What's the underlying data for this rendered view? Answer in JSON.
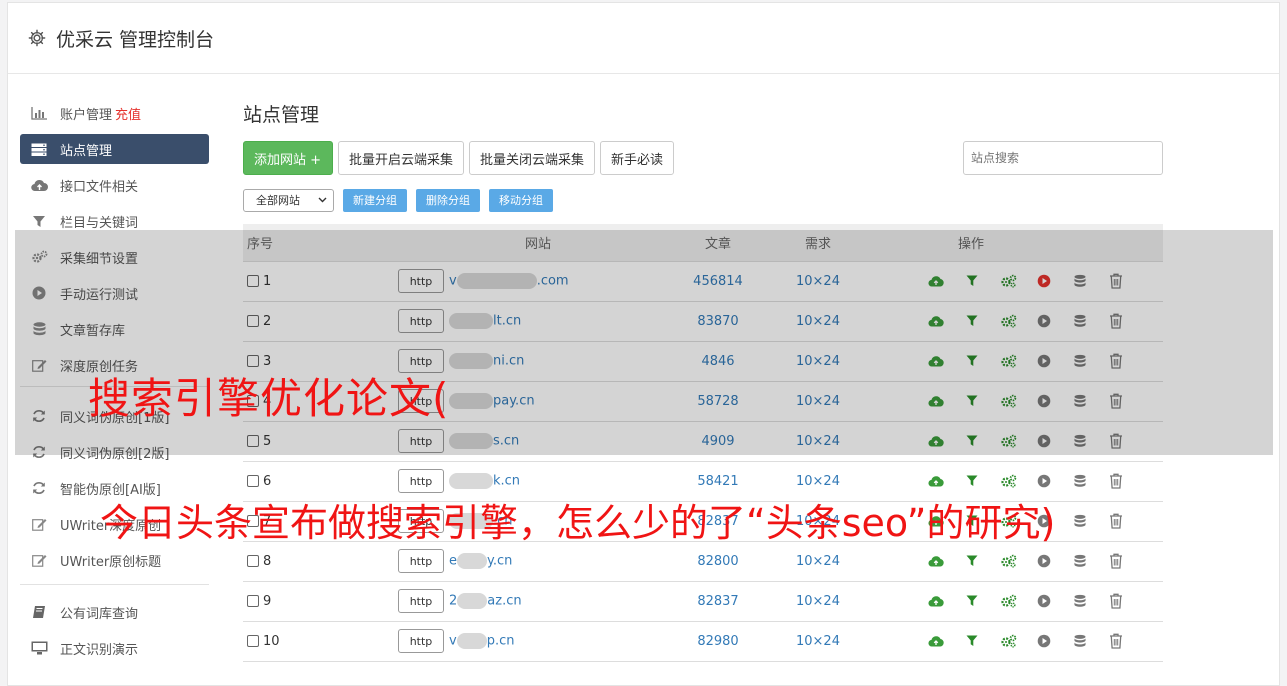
{
  "header": {
    "title": "优采云 管理控制台"
  },
  "sidebar": {
    "items": [
      {
        "label": "账户管理",
        "tag": "充值",
        "icon": "bar-chart-icon"
      },
      {
        "label": "站点管理",
        "icon": "server-icon",
        "active": true
      },
      {
        "label": "接口文件相关",
        "icon": "cloud-upload-icon"
      },
      {
        "label": "栏目与关键词",
        "icon": "filter-icon"
      },
      {
        "label": "采集细节设置",
        "icon": "cogs-icon"
      },
      {
        "label": "手动运行测试",
        "icon": "play-icon"
      },
      {
        "label": "文章暂存库",
        "icon": "database-icon"
      },
      {
        "label": "深度原创任务",
        "icon": "edit-icon"
      }
    ],
    "items2": [
      {
        "label": "同义词伪原创[1版]",
        "icon": "refresh-icon"
      },
      {
        "label": "同义词伪原创[2版]",
        "icon": "refresh-icon"
      },
      {
        "label": "智能伪原创[AI版]",
        "icon": "refresh-icon"
      },
      {
        "label": "UWriter深度原创",
        "icon": "edit-icon"
      },
      {
        "label": "UWriter原创标题",
        "icon": "edit-icon"
      }
    ],
    "items3": [
      {
        "label": "公有词库查询",
        "icon": "book-icon"
      },
      {
        "label": "正文识别演示",
        "icon": "monitor-icon"
      }
    ]
  },
  "main": {
    "title": "站点管理",
    "add_button": "添加网站 +",
    "batch_open": "批量开启云端采集",
    "batch_close": "批量关闭云端采集",
    "newbie": "新手必读",
    "search_placeholder": "站点搜索",
    "group_select": "全部网站",
    "new_group": "新建分组",
    "delete_group": "删除分组",
    "move_group": "移动分组"
  },
  "table": {
    "headers": {
      "idx": "序号",
      "site": "网站",
      "articles": "文章",
      "demand": "需求",
      "ops": "操作"
    },
    "rows": [
      {
        "idx": "1",
        "proto": "http",
        "pre": "v",
        "suf": ".com",
        "articles": "456814",
        "demand": "10×24",
        "running": true
      },
      {
        "idx": "2",
        "proto": "http",
        "pre": "",
        "suf": "lt.cn",
        "articles": "83870",
        "demand": "10×24"
      },
      {
        "idx": "3",
        "proto": "http",
        "pre": "",
        "suf": "ni.cn",
        "articles": "4846",
        "demand": "10×24"
      },
      {
        "idx": "4",
        "proto": "http",
        "pre": "",
        "suf": "pay.cn",
        "articles": "58728",
        "demand": "10×24"
      },
      {
        "idx": "5",
        "proto": "http",
        "pre": "",
        "suf": "s.cn",
        "articles": "4909",
        "demand": "10×24"
      },
      {
        "idx": "6",
        "proto": "http",
        "pre": "",
        "suf": "k.cn",
        "articles": "58421",
        "demand": "10×24"
      },
      {
        "idx": "7",
        "proto": "http",
        "pre": "",
        "suf": ".cn",
        "articles": "82837",
        "demand": "10×24"
      },
      {
        "idx": "8",
        "proto": "http",
        "pre": "e",
        "suf": "y.cn",
        "articles": "82800",
        "demand": "10×24"
      },
      {
        "idx": "9",
        "proto": "http",
        "pre": "2",
        "suf": "az.cn",
        "articles": "82837",
        "demand": "10×24"
      },
      {
        "idx": "10",
        "proto": "http",
        "pre": "v",
        "suf": "p.cn",
        "articles": "82980",
        "demand": "10×24"
      }
    ]
  },
  "overlay": {
    "caption1": "搜索引擎优化论文(",
    "caption2": "今日头条宣布做搜索引擎，怎么少的了“头条seo”的研究)"
  },
  "colors": {
    "active_nav": "#3a4e6b",
    "green": "#5cb85c",
    "link": "#337ab7",
    "caption": "#f01414",
    "stop": "#e5322d"
  }
}
